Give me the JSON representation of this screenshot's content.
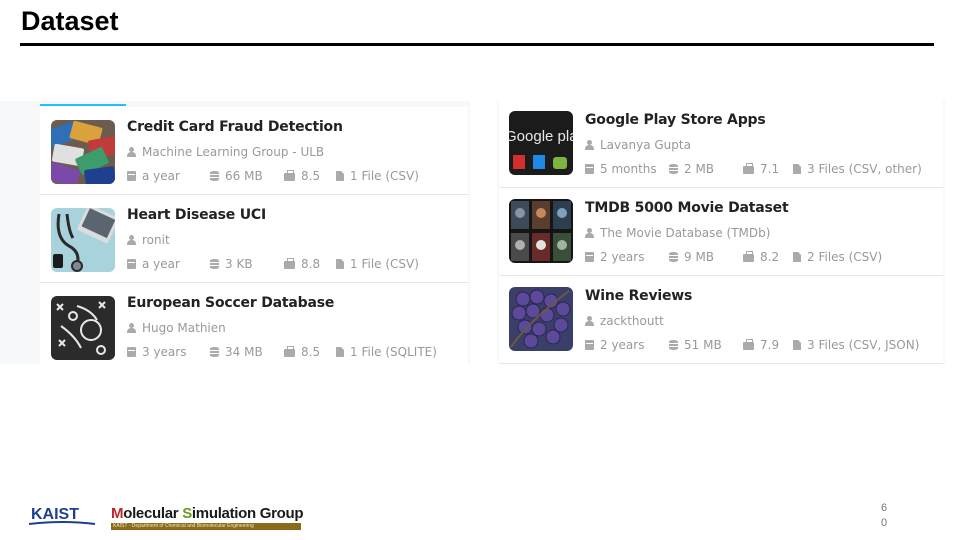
{
  "slide": {
    "title": "Dataset",
    "page_number": "60"
  },
  "left_column": [
    {
      "title": "Credit Card Fraud Detection",
      "owner": "Machine Learning Group - ULB",
      "age": "a year",
      "size": "66 MB",
      "score": "8.5",
      "files": "1 File (CSV)",
      "thumb": "credit-cards-image"
    },
    {
      "title": "Heart Disease UCI",
      "owner": "ronit",
      "age": "a year",
      "size": "3 KB",
      "score": "8.8",
      "files": "1 File (CSV)",
      "thumb": "stethoscope-laptop-image"
    },
    {
      "title": "European Soccer Database",
      "owner": "Hugo Mathien",
      "age": "3 years",
      "size": "34 MB",
      "score": "8.5",
      "files": "1 File (SQLITE)",
      "thumb": "soccer-tactics-board-image"
    }
  ],
  "right_column": [
    {
      "title": "Google Play Store Apps",
      "owner": "Lavanya Gupta",
      "age": "5 months",
      "size": "2 MB",
      "score": "7.1",
      "files": "3 Files (CSV, other)",
      "thumb": "google-play-image",
      "thumb_text": "Google play"
    },
    {
      "title": "TMDB 5000 Movie Dataset",
      "owner": "The Movie Database (TMDb)",
      "age": "2 years",
      "size": "9 MB",
      "score": "8.2",
      "files": "2 Files (CSV)",
      "thumb": "movie-posters-image"
    },
    {
      "title": "Wine Reviews",
      "owner": "zackthoutt",
      "age": "2 years",
      "size": "51 MB",
      "score": "7.9",
      "files": "3 Files (CSV, JSON)",
      "thumb": "grapes-image"
    }
  ],
  "footer": {
    "kaist_logo": "KAIST",
    "group_name_prefix": "M",
    "group_name_rest1": "olecular ",
    "group_name_s": "S",
    "group_name_rest2": "imulation Group",
    "group_subtitle": "KAIST · Department of Chemical and Biomolecular Engineering"
  },
  "colors": {
    "accent": "#20beff",
    "meta_text": "#999999",
    "msg_red": "#c0272d",
    "msg_green": "#6a9a1f",
    "kaist_blue": "#1f3f8f"
  }
}
